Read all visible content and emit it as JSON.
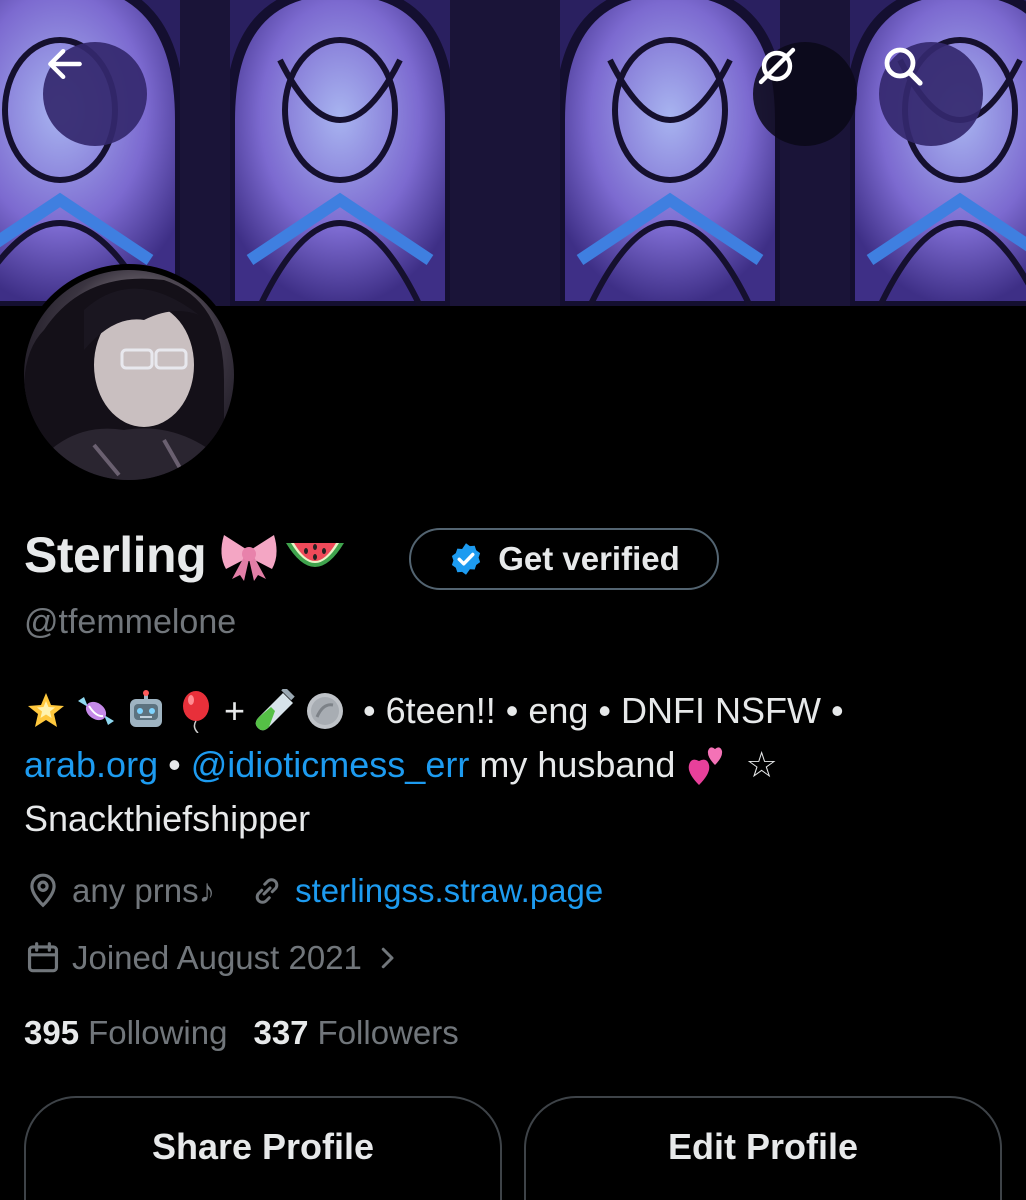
{
  "header": {
    "back_icon": "arrow-left-icon",
    "grok_icon": "grok-icon",
    "search_icon": "search-icon"
  },
  "profile": {
    "display_name": "Sterling",
    "name_emojis": [
      "ribbon",
      "watermelon"
    ],
    "get_verified_label": "Get verified",
    "handle": "@tfemmelone"
  },
  "bio": {
    "line1_emojis": [
      "glowing-star",
      "candy",
      "robot",
      "balloon",
      "plus",
      "test-tube",
      "coin"
    ],
    "line1_plus": "+",
    "line1_text": " • 6teen!! • eng • DNFI NSFW •",
    "line2_link1": "arab.org",
    "line2_sep": " • ",
    "line2_mention": "@idioticmess_err",
    "line2_text": " my husband ",
    "line2_star": " ☆",
    "line3_text": "Snackthiefshipper"
  },
  "meta": {
    "location": "any prns♪",
    "website": "sterlingss.straw.page",
    "joined": "Joined August 2021"
  },
  "stats": {
    "following_count": "395",
    "following_label": "Following",
    "followers_count": "337",
    "followers_label": "Followers"
  },
  "actions": {
    "share_label": "Share Profile",
    "edit_label": "Edit Profile"
  },
  "colors": {
    "link": "#1d9bf0",
    "muted": "#71767b",
    "text": "#e7e9ea",
    "verified_badge": "#1d9bf0"
  }
}
